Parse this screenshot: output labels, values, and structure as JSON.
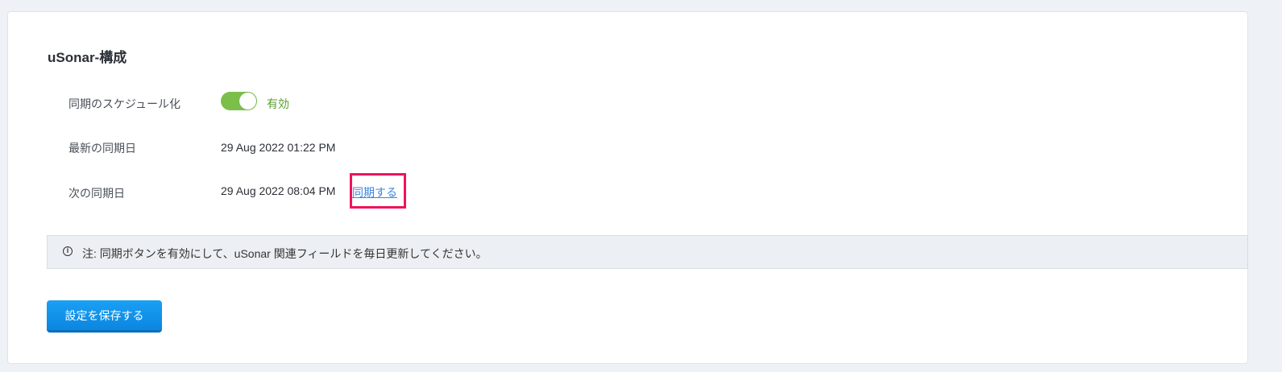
{
  "title": "uSonar-構成",
  "rows": {
    "schedule": {
      "label": "同期のスケジュール化",
      "state": "有効"
    },
    "last_sync": {
      "label": "最新の同期日",
      "value": "29 Aug 2022 01:22 PM"
    },
    "next_sync": {
      "label": "次の同期日",
      "value": "29 Aug 2022 08:04 PM",
      "link": "同期する"
    }
  },
  "note": {
    "icon": "info-icon",
    "text": "注: 同期ボタンを有効にして、uSonar 関連フィールドを毎日更新してください。"
  },
  "save_button": "設定を保存する",
  "colors": {
    "toggle_on": "#7bbf4a",
    "link": "#3a86e0",
    "highlight_border": "#f0135a",
    "button": "#0b86e0"
  }
}
